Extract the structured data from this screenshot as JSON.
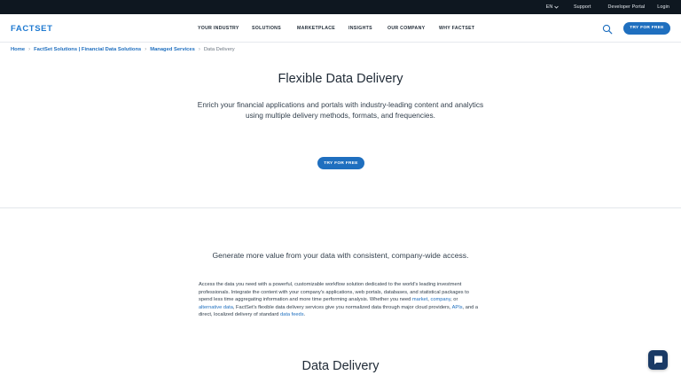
{
  "utility_bar": {
    "language": "EN",
    "support": "Support",
    "developer_portal": "Developer Portal",
    "login": "Login"
  },
  "header": {
    "logo": "FACTSET",
    "nav": [
      "YOUR INDUSTRY",
      "SOLUTIONS",
      "MARKETPLACE",
      "INSIGHTS",
      "OUR COMPANY",
      "WHY FACTSET"
    ],
    "cta": "TRY FOR FREE"
  },
  "breadcrumb": {
    "items": [
      "Home",
      "FactSet Solutions | Financial Data Solutions",
      "Managed Services"
    ],
    "current": "Data Delivery"
  },
  "hero": {
    "title": "Flexible Data Delivery",
    "description": "Enrich your financial applications and portals with industry-leading content and analytics using multiple delivery methods, formats, and frequencies.",
    "cta": "TRY FOR FREE"
  },
  "section": {
    "subtitle": "Generate more value from your data with consistent, company-wide access.",
    "body_parts": [
      "Access the data you need with a powerful, customizable workflow solution dedicated to the world's leading investment professionals. Integrate the content with your company's applications, web portals, databases, and statistical packages to spend less time aggregating information and more time performing analysis. Whether you need ",
      "market",
      ", ",
      "company",
      ", or ",
      "alternative data",
      ", FactSet's flexible data delivery services give you normalized data through major cloud providers, ",
      "APIs",
      ", and a direct, localized delivery of standard ",
      "data feeds",
      "."
    ],
    "next_title": "Data Delivery"
  },
  "colors": {
    "brand_blue": "#1f6fbf",
    "topbar": "#0e1720",
    "chat": "#1a3a66"
  }
}
